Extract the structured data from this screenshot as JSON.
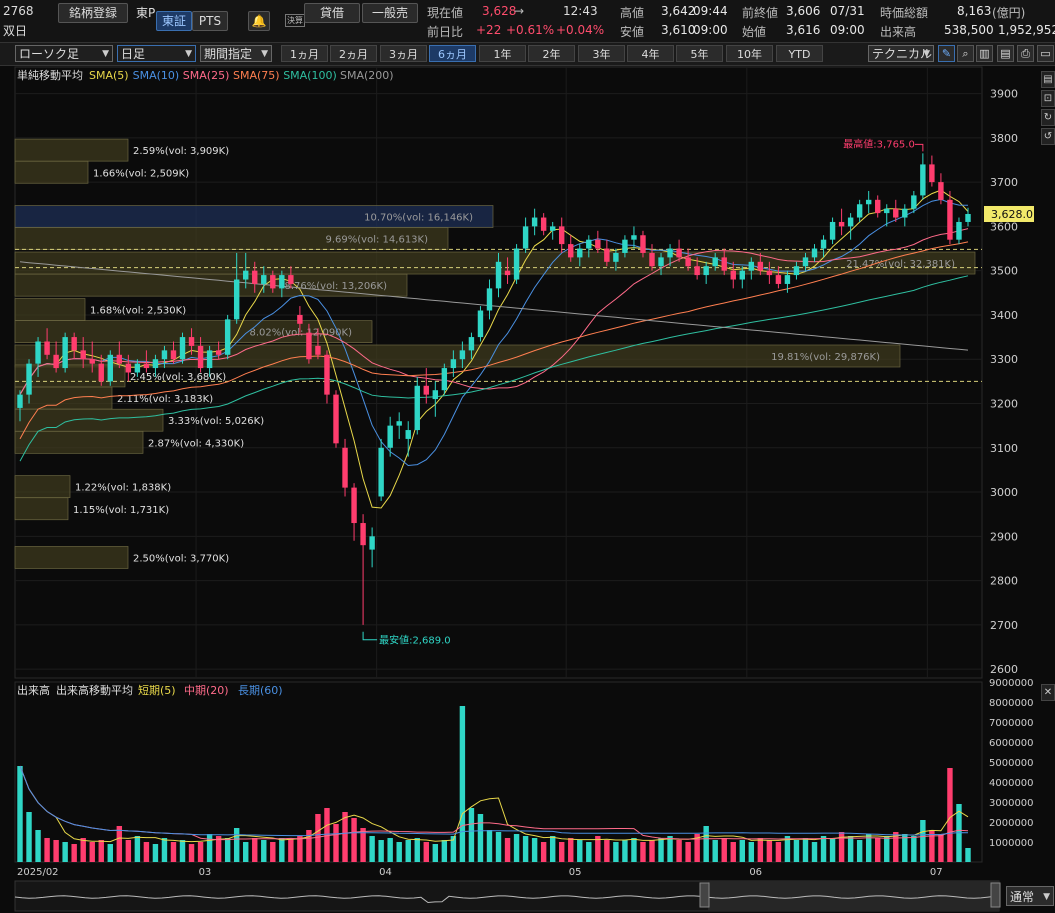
{
  "header": {
    "code": "2768",
    "name": "双日",
    "market": "東P",
    "register_btn": "銘柄登録",
    "tab_tse": "東証",
    "tab_pts": "PTS",
    "kessan": "決算",
    "credit": "貸借",
    "general": "一般売",
    "current_label": "現在値",
    "current_value": "3,628",
    "current_arrow": "→",
    "time": "12:43",
    "change_label": "前日比",
    "change_value": "+22",
    "change_pct": "+0.61%",
    "change_pct2": "+0.04%",
    "high_label": "高値",
    "high_value": "3,642",
    "high_time": "09:44",
    "low_label": "安値",
    "low_value": "3,610",
    "low_time": "09:00",
    "prevclose_label": "前終値",
    "prevclose_value": "3,606",
    "prevclose_date": "07/31",
    "open_label": "始値",
    "open_value": "3,616",
    "open_time": "09:00",
    "mcap_label": "時価総額",
    "mcap_value": "8,163",
    "mcap_unit": "(億円)",
    "volume_label": "出来高",
    "volume_value": "538,500",
    "turnover_value": "1,952,952"
  },
  "toolbar": {
    "chart_type": "ローソク足",
    "interval": "日足",
    "period_label": "期間指定",
    "periods": [
      "1ヵ月",
      "2ヵ月",
      "3ヵ月",
      "6ヵ月",
      "1年",
      "2年",
      "3年",
      "4年",
      "5年",
      "10年",
      "YTD"
    ],
    "active_period": "6ヵ月",
    "technical": "テクニカル"
  },
  "legend": {
    "title": "単純移動平均",
    "items": [
      {
        "label": "SMA(5)",
        "color": "#e8d84a"
      },
      {
        "label": "SMA(10)",
        "color": "#4a90e2"
      },
      {
        "label": "SMA(25)",
        "color": "#ff6b8a"
      },
      {
        "label": "SMA(75)",
        "color": "#ff7f50"
      },
      {
        "label": "SMA(100)",
        "color": "#2fbfa0"
      },
      {
        "label": "SMA(200)",
        "color": "#999999"
      }
    ]
  },
  "vol_legend": {
    "title": "出来高",
    "ma_title": "出来高移動平均",
    "items": [
      {
        "label": "短期(5)",
        "color": "#e8d84a"
      },
      {
        "label": "中期(20)",
        "color": "#ff6b8a"
      },
      {
        "label": "長期(60)",
        "color": "#4a90e2"
      }
    ]
  },
  "annotations": {
    "high": "最高値:3,765.0",
    "low": "最安値:2,689.0",
    "current_tag": "3,628.0"
  },
  "xaxis": {
    "labels": [
      "2025/02",
      "03",
      "04",
      "05",
      "06",
      "07"
    ]
  },
  "footer": {
    "mode": "通常"
  },
  "chart_data": [
    {
      "type": "candlestick",
      "title": "",
      "ylim": [
        2580,
        3960
      ],
      "yticks": [
        2600,
        2700,
        2800,
        2900,
        3000,
        3100,
        3200,
        3300,
        3400,
        3500,
        3600,
        3700,
        3800,
        3900
      ],
      "month_starts": {
        "03": 20,
        "04": 40,
        "05": 61,
        "06": 81,
        "07": 101
      },
      "candles": [
        [
          3190,
          3230,
          3160,
          3220
        ],
        [
          3220,
          3300,
          3200,
          3290
        ],
        [
          3290,
          3350,
          3260,
          3340
        ],
        [
          3340,
          3370,
          3300,
          3310
        ],
        [
          3310,
          3340,
          3270,
          3280
        ],
        [
          3280,
          3360,
          3270,
          3350
        ],
        [
          3350,
          3360,
          3300,
          3320
        ],
        [
          3320,
          3350,
          3280,
          3300
        ],
        [
          3300,
          3340,
          3270,
          3290
        ],
        [
          3290,
          3310,
          3240,
          3250
        ],
        [
          3250,
          3320,
          3240,
          3310
        ],
        [
          3310,
          3340,
          3280,
          3290
        ],
        [
          3290,
          3310,
          3250,
          3270
        ],
        [
          3270,
          3300,
          3260,
          3290
        ],
        [
          3290,
          3320,
          3270,
          3280
        ],
        [
          3280,
          3310,
          3260,
          3300
        ],
        [
          3300,
          3330,
          3280,
          3320
        ],
        [
          3320,
          3340,
          3290,
          3300
        ],
        [
          3300,
          3360,
          3290,
          3350
        ],
        [
          3350,
          3370,
          3310,
          3330
        ],
        [
          3330,
          3350,
          3270,
          3280
        ],
        [
          3280,
          3330,
          3260,
          3320
        ],
        [
          3320,
          3340,
          3300,
          3310
        ],
        [
          3310,
          3400,
          3300,
          3390
        ],
        [
          3390,
          3540,
          3380,
          3480
        ],
        [
          3480,
          3540,
          3460,
          3500
        ],
        [
          3500,
          3520,
          3450,
          3470
        ],
        [
          3470,
          3510,
          3450,
          3490
        ],
        [
          3490,
          3500,
          3450,
          3460
        ],
        [
          3460,
          3500,
          3440,
          3490
        ],
        [
          3490,
          3510,
          3460,
          3470
        ],
        [
          3400,
          3420,
          3360,
          3380
        ],
        [
          3360,
          3380,
          3290,
          3300
        ],
        [
          3330,
          3370,
          3300,
          3310
        ],
        [
          3310,
          3320,
          3200,
          3220
        ],
        [
          3220,
          3230,
          3100,
          3110
        ],
        [
          3100,
          3120,
          2990,
          3010
        ],
        [
          3010,
          3020,
          2890,
          2930
        ],
        [
          2930,
          2950,
          2700,
          2880
        ],
        [
          2870,
          2920,
          2830,
          2900
        ],
        [
          2990,
          3120,
          2980,
          3100
        ],
        [
          3100,
          3170,
          3080,
          3150
        ],
        [
          3150,
          3180,
          3120,
          3160
        ],
        [
          3120,
          3160,
          3080,
          3140
        ],
        [
          3140,
          3260,
          3130,
          3240
        ],
        [
          3240,
          3280,
          3200,
          3220
        ],
        [
          3210,
          3250,
          3170,
          3230
        ],
        [
          3230,
          3290,
          3220,
          3280
        ],
        [
          3280,
          3320,
          3260,
          3300
        ],
        [
          3300,
          3340,
          3280,
          3320
        ],
        [
          3320,
          3360,
          3300,
          3350
        ],
        [
          3350,
          3420,
          3340,
          3410
        ],
        [
          3410,
          3480,
          3390,
          3460
        ],
        [
          3460,
          3540,
          3440,
          3520
        ],
        [
          3500,
          3530,
          3470,
          3490
        ],
        [
          3480,
          3560,
          3470,
          3550
        ],
        [
          3550,
          3620,
          3540,
          3600
        ],
        [
          3600,
          3640,
          3580,
          3620
        ],
        [
          3620,
          3630,
          3580,
          3590
        ],
        [
          3590,
          3610,
          3570,
          3600
        ],
        [
          3600,
          3620,
          3540,
          3560
        ],
        [
          3560,
          3580,
          3520,
          3530
        ],
        [
          3530,
          3560,
          3510,
          3550
        ],
        [
          3550,
          3580,
          3530,
          3570
        ],
        [
          3570,
          3590,
          3540,
          3550
        ],
        [
          3550,
          3570,
          3510,
          3520
        ],
        [
          3520,
          3550,
          3500,
          3540
        ],
        [
          3540,
          3580,
          3530,
          3570
        ],
        [
          3570,
          3600,
          3550,
          3580
        ],
        [
          3580,
          3590,
          3530,
          3540
        ],
        [
          3540,
          3560,
          3500,
          3510
        ],
        [
          3510,
          3540,
          3490,
          3530
        ],
        [
          3530,
          3560,
          3510,
          3550
        ],
        [
          3550,
          3570,
          3520,
          3530
        ],
        [
          3530,
          3550,
          3500,
          3510
        ],
        [
          3510,
          3530,
          3480,
          3490
        ],
        [
          3490,
          3520,
          3470,
          3510
        ],
        [
          3510,
          3540,
          3500,
          3530
        ],
        [
          3530,
          3550,
          3490,
          3500
        ],
        [
          3500,
          3520,
          3460,
          3480
        ],
        [
          3480,
          3510,
          3460,
          3500
        ],
        [
          3500,
          3530,
          3480,
          3520
        ],
        [
          3520,
          3540,
          3490,
          3500
        ],
        [
          3500,
          3520,
          3470,
          3490
        ],
        [
          3490,
          3510,
          3460,
          3470
        ],
        [
          3470,
          3500,
          3450,
          3490
        ],
        [
          3490,
          3520,
          3480,
          3510
        ],
        [
          3510,
          3540,
          3500,
          3530
        ],
        [
          3530,
          3560,
          3520,
          3550
        ],
        [
          3550,
          3580,
          3530,
          3570
        ],
        [
          3570,
          3620,
          3560,
          3610
        ],
        [
          3610,
          3640,
          3580,
          3600
        ],
        [
          3600,
          3630,
          3570,
          3620
        ],
        [
          3620,
          3660,
          3610,
          3650
        ],
        [
          3650,
          3680,
          3630,
          3660
        ],
        [
          3660,
          3670,
          3620,
          3630
        ],
        [
          3630,
          3650,
          3600,
          3640
        ],
        [
          3640,
          3660,
          3610,
          3620
        ],
        [
          3620,
          3650,
          3600,
          3640
        ],
        [
          3640,
          3680,
          3630,
          3670
        ],
        [
          3670,
          3765,
          3660,
          3740
        ],
        [
          3740,
          3760,
          3690,
          3700
        ],
        [
          3700,
          3720,
          3650,
          3660
        ],
        [
          3660,
          3680,
          3560,
          3570
        ],
        [
          3570,
          3620,
          3560,
          3610
        ],
        [
          3610,
          3642,
          3600,
          3628
        ]
      ],
      "volume_ylim": [
        0,
        9000000
      ],
      "volume_yticks": [
        1000000,
        2000000,
        3000000,
        4000000,
        5000000,
        6000000,
        7000000,
        8000000,
        9000000
      ],
      "volume": [
        4800000,
        2500000,
        1600000,
        1200000,
        1100000,
        1000000,
        900000,
        1200000,
        1000000,
        1100000,
        900000,
        1800000,
        1100000,
        1300000,
        1000000,
        900000,
        1200000,
        1000000,
        1100000,
        900000,
        1000000,
        1400000,
        1300000,
        1200000,
        1700000,
        1000000,
        1200000,
        1100000,
        1000000,
        1200000,
        1200000,
        1300000,
        1600000,
        2400000,
        2700000,
        1900000,
        2500000,
        2200000,
        1700000,
        1300000,
        1100000,
        1200000,
        1000000,
        1100000,
        1200000,
        1000000,
        900000,
        1100000,
        1300000,
        7800000,
        2700000,
        2400000,
        1600000,
        1500000,
        1200000,
        1400000,
        1300000,
        1200000,
        1000000,
        1300000,
        1000000,
        1200000,
        1100000,
        1000000,
        1300000,
        1100000,
        1000000,
        1100000,
        1200000,
        1000000,
        1100000,
        1200000,
        1300000,
        1100000,
        1000000,
        1400000,
        1800000,
        1100000,
        1200000,
        1000000,
        1100000,
        1000000,
        1200000,
        1100000,
        1000000,
        1300000,
        1100000,
        1200000,
        1000000,
        1300000,
        1200000,
        1500000,
        1300000,
        1100000,
        1400000,
        1200000,
        1300000,
        1500000,
        1400000,
        1300000,
        2100000,
        1600000,
        1400000,
        4700000,
        2900000,
        700000
      ],
      "volume_profile": [
        {
          "label": "2.59%(vol: 3,909K)",
          "price": 3770
        },
        {
          "label": "1.66%(vol: 2,509K)",
          "price": 3720
        },
        {
          "label": "10.70%(vol: 16,146K)",
          "price": 3620
        },
        {
          "label": "9.69%(vol: 14,613K)",
          "price": 3570
        },
        {
          "label": "21.47%(vol: 32,381K)",
          "price": 3515
        },
        {
          "label": "8.76%(vol: 13,206K)",
          "price": 3465
        },
        {
          "label": "1.68%(vol: 2,530K)",
          "price": 3410
        },
        {
          "label": "8.02%(vol: 12,090K)",
          "price": 3360
        },
        {
          "label": "19.81%(vol: 29,876K)",
          "price": 3305
        },
        {
          "label": "2.45%(vol: 3,680K)",
          "price": 3260
        },
        {
          "label": "2.11%(vol: 3,183K)",
          "price": 3210
        },
        {
          "label": "3.33%(vol: 5,026K)",
          "price": 3160
        },
        {
          "label": "2.87%(vol: 4,330K)",
          "price": 3110
        },
        {
          "label": "1.22%(vol: 1,838K)",
          "price": 3010
        },
        {
          "label": "1.15%(vol: 1,731K)",
          "price": 2960
        },
        {
          "label": "2.50%(vol: 3,770K)",
          "price": 2850
        }
      ],
      "hlines": [
        3548,
        3507,
        3250
      ]
    }
  ]
}
